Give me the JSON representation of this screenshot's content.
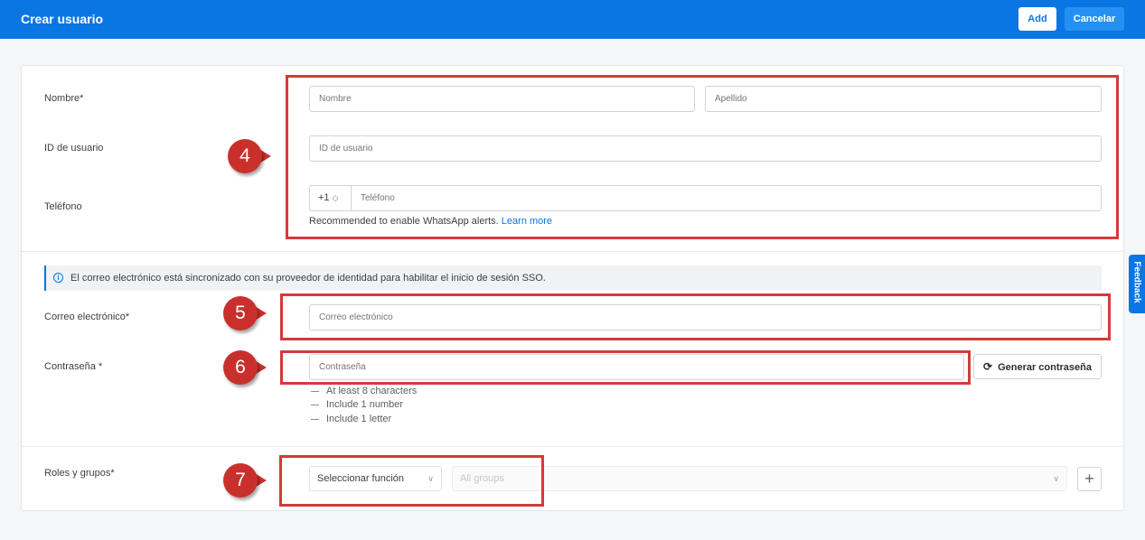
{
  "header": {
    "title": "Crear usuario",
    "add_label": "Add",
    "cancel_label": "Cancelar"
  },
  "form": {
    "name": {
      "label": "Nombre*",
      "first_placeholder": "Nombre",
      "last_placeholder": "Apellido"
    },
    "user_id": {
      "label": "ID de usuario",
      "placeholder": "ID de usuario"
    },
    "phone": {
      "label": "Teléfono",
      "prefix": "+1",
      "placeholder": "Teléfono",
      "hint": "Recommended to enable WhatsApp alerts.",
      "hint_link": "Learn more"
    },
    "info_banner": "El correo electrónico está sincronizado con su proveedor de identidad para habilitar el inicio de sesión SSO.",
    "email": {
      "label": "Correo electrónico*",
      "placeholder": "Correo electrónico"
    },
    "password": {
      "label": "Contraseña *",
      "placeholder": "Contraseña",
      "generate_label": "Generar contraseña",
      "rules": [
        "At least 8 characters",
        "Include 1 number",
        "Include 1 letter"
      ]
    },
    "roles": {
      "label": "Roles y grupos*",
      "role_select": "Seleccionar función",
      "groups_placeholder": "All groups",
      "add_symbol": "+"
    }
  },
  "callouts": {
    "c4": "4",
    "c5": "5",
    "c6": "6",
    "c7": "7"
  },
  "feedback_label": "Feedback",
  "colors": {
    "accent": "#0a76e3",
    "callout": "#d43a3a"
  }
}
